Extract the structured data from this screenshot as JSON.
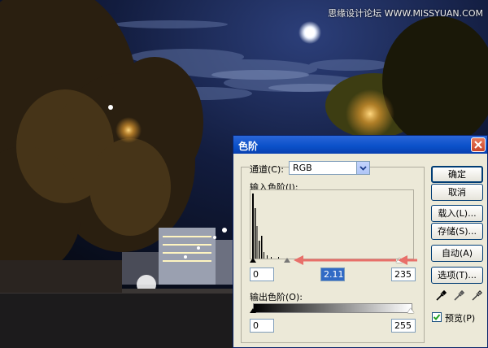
{
  "watermark": "思缘设计论坛 WWW.MISSYUAN.COM",
  "dialog": {
    "title": "色阶",
    "channel_label": "通道(C):",
    "channel_value": "RGB",
    "input_levels_label": "输入色阶(I):",
    "input_black": "0",
    "input_gamma": "2.11",
    "input_white": "235",
    "output_levels_label": "输出色阶(O):",
    "output_black": "0",
    "output_white": "255",
    "buttons": {
      "ok": "确定",
      "cancel": "取消",
      "load": "载入(L)...",
      "save": "存储(S)...",
      "auto": "自动(A)",
      "options": "选项(T)..."
    },
    "preview_label": "预览(P)",
    "preview_checked": true
  },
  "colors": {
    "title_bar": "#0a50c8",
    "dialog_bg": "#ece9d8",
    "annotation_arrow": "#e8706a"
  }
}
